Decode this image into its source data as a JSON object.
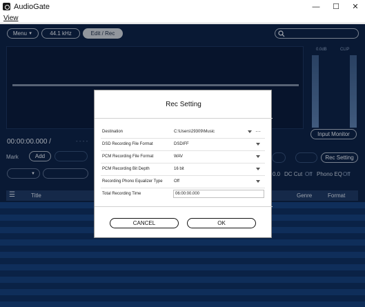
{
  "window": {
    "title": "AudioGate",
    "minimize": "—",
    "maximize": "☐",
    "close": "✕"
  },
  "menu": {
    "view": "View"
  },
  "toolbar": {
    "menu_label": "Menu",
    "menu_arrow": "▼",
    "sample_rate": "44.1 kHz",
    "edit_rec": "Edit / Rec",
    "search_icon": "search-icon"
  },
  "meters": {
    "db_label": "0.0dB",
    "clip_label": "CLIP"
  },
  "transport": {
    "time": "00:00:00.000 /",
    "dashes": "- - - -"
  },
  "controls": {
    "input_monitor": "Input Monitor",
    "mark": "Mark",
    "add": "Add",
    "rec_setting": "Rec Setting",
    "dc_cut": "DC Cut",
    "dc_cut_value": "Off",
    "phono_eq": "Phono EQ",
    "phono_eq_value": "Off",
    "option_prefix": "0.0",
    "dropdown_arrow": "▼"
  },
  "list": {
    "title_col": "Title",
    "genre_col": "Genre",
    "format_col": "Format"
  },
  "dialog": {
    "title": "Rec Setting",
    "rows": [
      {
        "label": "Destination",
        "value": "C:\\Users\\29309\\Music"
      },
      {
        "label": "DSD Recording File Format",
        "value": "DSDIFF"
      },
      {
        "label": "PCM Recording File Format",
        "value": "WAV"
      },
      {
        "label": "PCM Recording Bit Depth",
        "value": "16 bit"
      },
      {
        "label": "Recording Phono Equalizer Type",
        "value": "Off"
      },
      {
        "label": "Total Recording Time",
        "value": "06:00:00.000"
      }
    ],
    "more": "···",
    "cancel": "CANCEL",
    "ok": "OK"
  }
}
